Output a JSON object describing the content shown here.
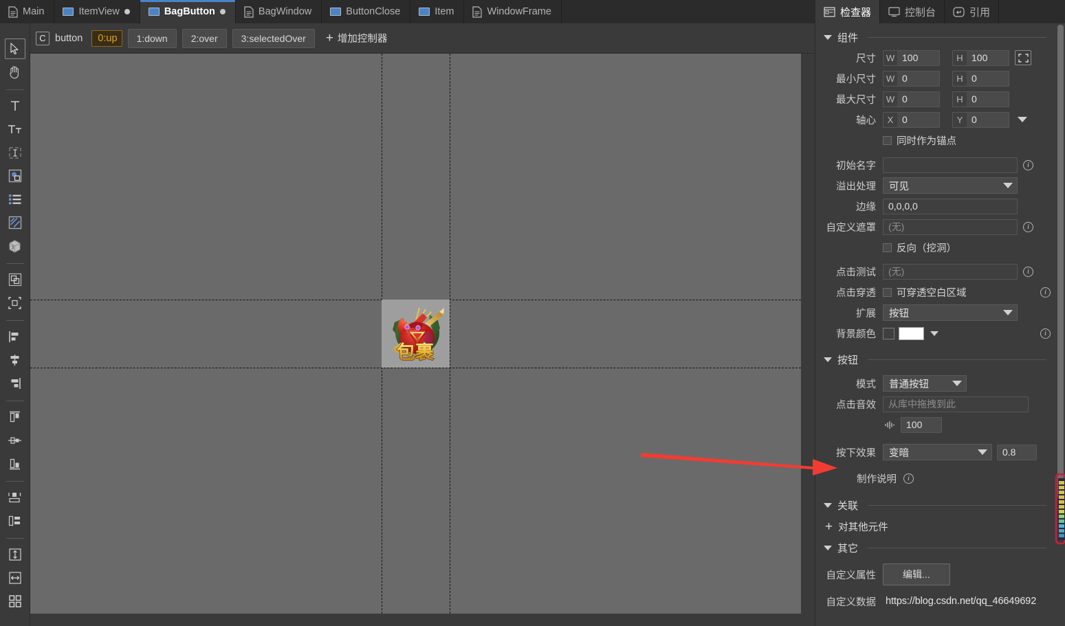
{
  "tabs": [
    {
      "label": "Main",
      "icon": "document-icon",
      "modified": false,
      "active": false
    },
    {
      "label": "ItemView",
      "icon": "component-icon",
      "modified": true,
      "active": false
    },
    {
      "label": "BagButton",
      "icon": "component-icon",
      "modified": true,
      "active": true
    },
    {
      "label": "BagWindow",
      "icon": "document-icon",
      "modified": false,
      "active": false
    },
    {
      "label": "ButtonClose",
      "icon": "component-icon",
      "modified": false,
      "active": false
    },
    {
      "label": "Item",
      "icon": "component-icon",
      "modified": false,
      "active": false
    },
    {
      "label": "WindowFrame",
      "icon": "document-icon",
      "modified": false,
      "active": false
    }
  ],
  "controller_bar": {
    "badge": "C",
    "name": "button",
    "states": [
      {
        "label": "0:up",
        "selected": true
      },
      {
        "label": "1:down",
        "selected": false
      },
      {
        "label": "2:over",
        "selected": false
      },
      {
        "label": "3:selectedOver",
        "selected": false
      }
    ],
    "add_controller": "增加控制器",
    "add_icon": "plus-icon"
  },
  "left_toolbar": {
    "tools": [
      {
        "icon": "pointer-icon",
        "name": "select-tool",
        "active": true
      },
      {
        "icon": "hand-icon",
        "name": "pan-tool",
        "active": false
      },
      {
        "icon": "text-icon",
        "name": "text-tool",
        "active": false
      },
      {
        "icon": "rich-text-icon",
        "name": "rich-text-tool",
        "active": false
      },
      {
        "icon": "input-text-icon",
        "name": "input-text-tool",
        "active": false
      },
      {
        "icon": "loader-icon",
        "name": "loader-tool",
        "active": false
      },
      {
        "icon": "list-icon",
        "name": "list-tool",
        "active": false
      },
      {
        "icon": "graph-icon",
        "name": "graph-tool",
        "active": false
      },
      {
        "icon": "cube-3d-icon",
        "name": "cube-3d-tool",
        "active": false
      },
      {
        "icon": "group-icon",
        "name": "group-tool",
        "active": false
      },
      {
        "icon": "transform-icon",
        "name": "transform-tool",
        "active": false
      },
      {
        "icon": "align-left-icon",
        "name": "align-left",
        "active": false
      },
      {
        "icon": "align-center-h-icon",
        "name": "align-center-h",
        "active": false
      },
      {
        "icon": "align-right-icon",
        "name": "align-right",
        "active": false
      },
      {
        "icon": "align-top-icon",
        "name": "align-top",
        "active": false
      },
      {
        "icon": "align-middle-v-icon",
        "name": "align-middle-v",
        "active": false
      },
      {
        "icon": "align-bottom-icon",
        "name": "align-bottom",
        "active": false
      },
      {
        "icon": "distribute-h-icon",
        "name": "distribute-h",
        "active": false
      },
      {
        "icon": "distribute-v-icon",
        "name": "distribute-v",
        "active": false
      },
      {
        "icon": "size-height-icon",
        "name": "match-height",
        "active": false
      },
      {
        "icon": "size-width-icon",
        "name": "match-width",
        "active": false
      },
      {
        "icon": "grid-icon",
        "name": "grid-layout",
        "active": false
      }
    ]
  },
  "canvas": {
    "component_label": "包裹",
    "component_alt": "bag button artwork with red pouch, arrows and Chinese characters 包裹"
  },
  "inspector": {
    "tabs": [
      {
        "label": "检查器",
        "icon": "inspector-icon",
        "active": true
      },
      {
        "label": "控制台",
        "icon": "console-icon",
        "active": false
      },
      {
        "label": "引用",
        "icon": "reference-icon",
        "active": false
      }
    ],
    "sections": {
      "component": {
        "title": "组件",
        "size": {
          "label": "尺寸",
          "w_prefix": "W",
          "w": "100",
          "h_prefix": "H",
          "h": "100",
          "expand_icon": "expand-icon"
        },
        "min_size": {
          "label": "最小尺寸",
          "w_prefix": "W",
          "w": "0",
          "h_prefix": "H",
          "h": "0"
        },
        "max_size": {
          "label": "最大尺寸",
          "w_prefix": "W",
          "w": "0",
          "h_prefix": "H",
          "h": "0"
        },
        "pivot": {
          "label": "轴心",
          "x_prefix": "X",
          "x": "0",
          "y_prefix": "Y",
          "y": "0"
        },
        "anchor_checkbox": {
          "label": "同时作为锚点",
          "checked": false
        },
        "initial_name": {
          "label": "初始名字",
          "value": "",
          "placeholder": ""
        },
        "overflow": {
          "label": "溢出处理",
          "value": "可见"
        },
        "margin": {
          "label": "边缘",
          "value": "0,0,0,0"
        },
        "custom_mask": {
          "label": "自定义遮罩",
          "value": "(无)"
        },
        "reverse_checkbox": {
          "label": "反向（挖洞）",
          "checked": false
        },
        "hit_test": {
          "label": "点击测试",
          "value": "(无)"
        },
        "hit_through": {
          "label": "点击穿透",
          "checkbox_label": "可穿透空白区域",
          "checked": false
        },
        "extension": {
          "label": "扩展",
          "value": "按钮"
        },
        "bg_color": {
          "label": "背景颜色",
          "swatch": "#ffffff",
          "enabled_swatch": "#3f3f3f"
        }
      },
      "button": {
        "title": "按钮",
        "mode": {
          "label": "模式",
          "value": "普通按钮"
        },
        "click_sound": {
          "label": "点击音效",
          "placeholder": "从库中拖拽到此",
          "value": ""
        },
        "volume": {
          "icon": "volume-icon",
          "value": "100"
        },
        "press_effect": {
          "label": "按下效果",
          "value": "变暗",
          "amount": "0.8"
        },
        "production_note": {
          "label": "制作说明",
          "info_icon": "info-icon"
        }
      },
      "relation": {
        "title": "关联",
        "add_relation": "对其他元件",
        "add_icon": "plus-icon"
      },
      "other": {
        "title": "其它",
        "custom_props": {
          "label": "自定义属性",
          "button": "编辑..."
        },
        "custom_data": {
          "label": "自定义数据",
          "value": "https://blog.csdn.net/qq_46649692"
        }
      }
    }
  },
  "annotation": {
    "arrow_color": "#f23c32",
    "points_to": "按下效果"
  },
  "colors": {
    "accent": "#4a84c8",
    "selected_state": "#d9a22b",
    "canvas_bg": "#6a6a6a",
    "panel_bg": "#3c3c3c",
    "tabbar_bg": "#2b2b2b"
  }
}
